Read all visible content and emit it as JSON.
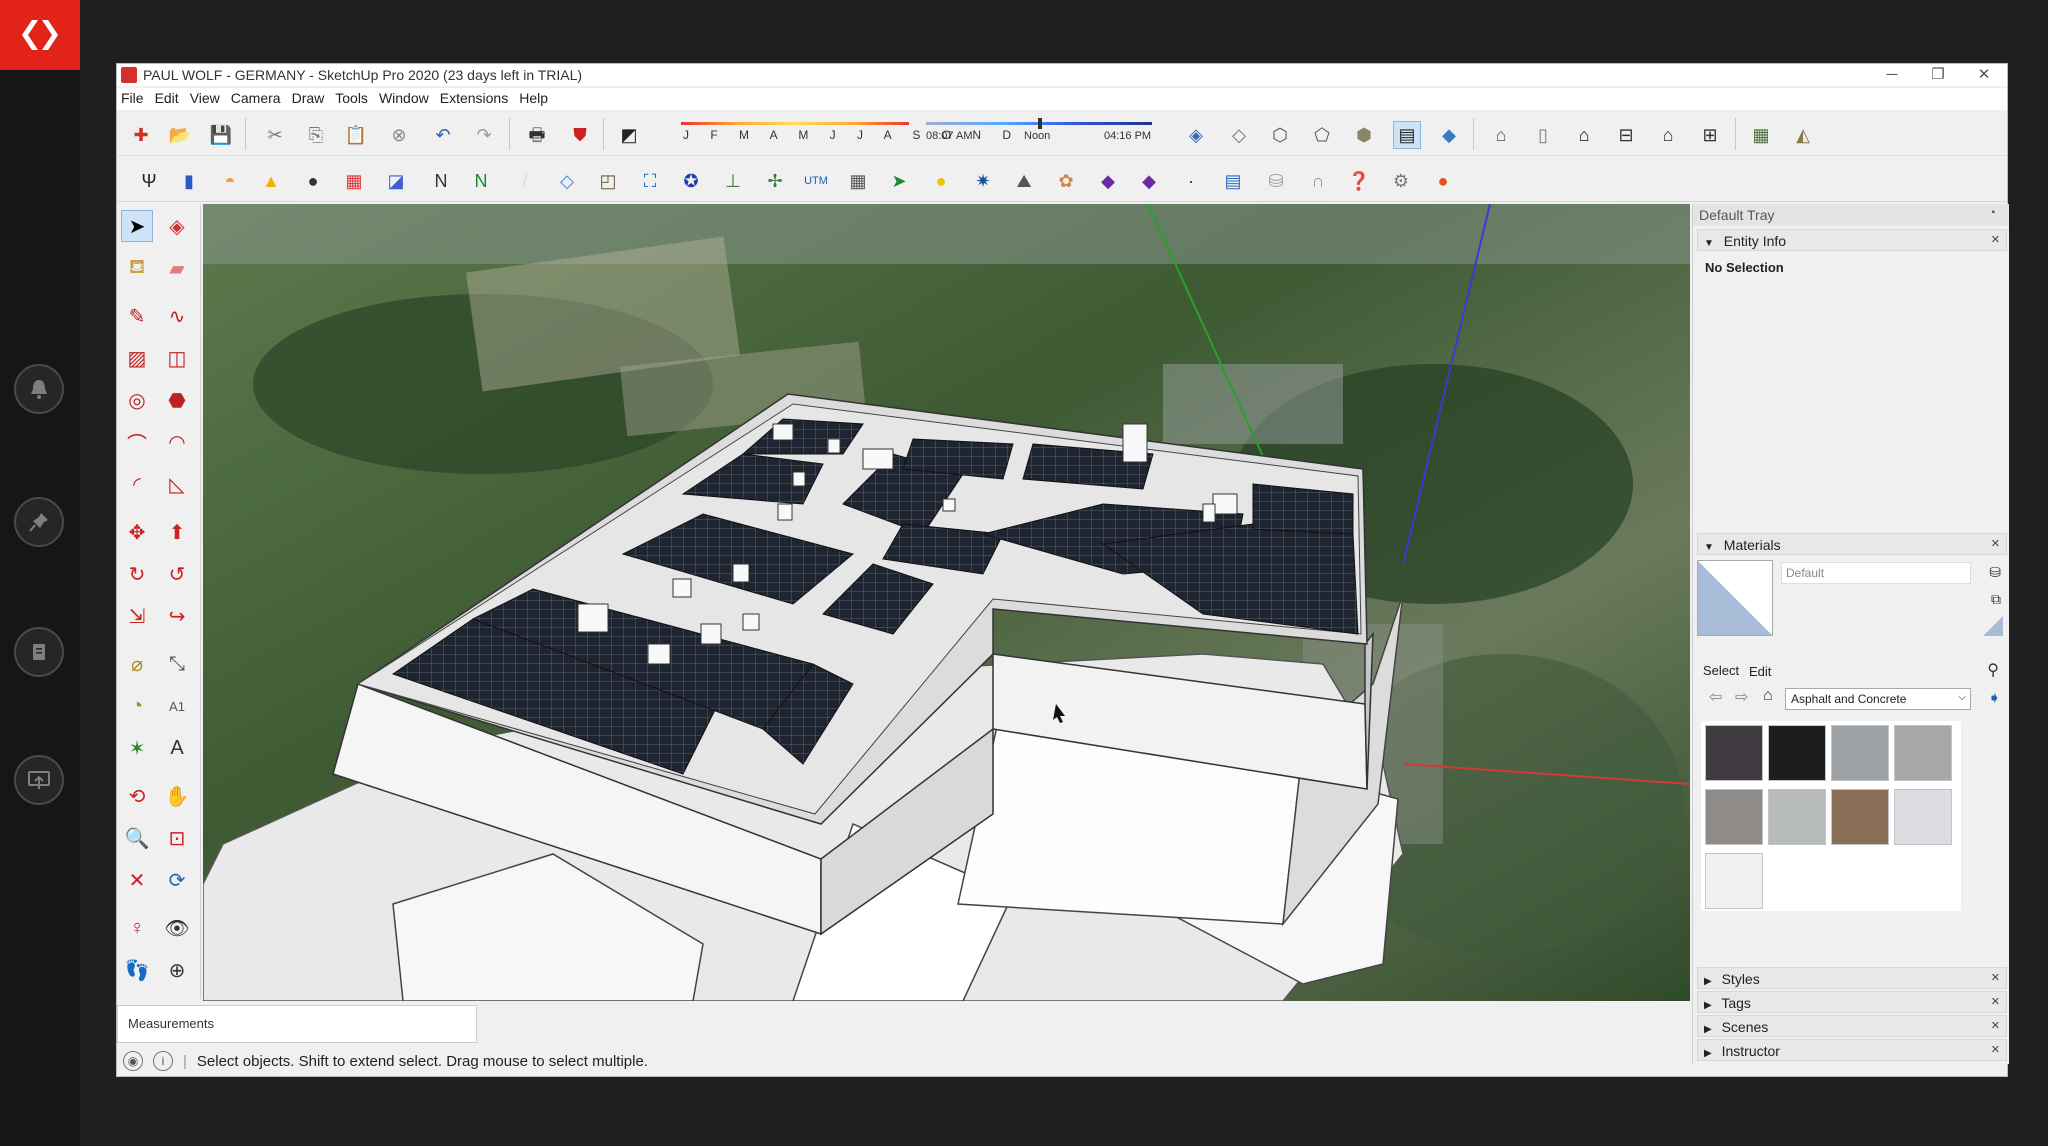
{
  "window": {
    "title": "PAUL WOLF - GERMANY - SketchUp Pro 2020 (23 days left in TRIAL)"
  },
  "menu": [
    "File",
    "Edit",
    "View",
    "Camera",
    "Draw",
    "Tools",
    "Window",
    "Extensions",
    "Help"
  ],
  "shadow": {
    "months": "J F M A M J J A S O N D",
    "time_start": "08:07 AM",
    "time_mid": "Noon",
    "time_end": "04:16 PM"
  },
  "tray": {
    "title": "Default Tray",
    "entity_info": {
      "label": "Entity Info",
      "selection": "No Selection"
    },
    "materials": {
      "label": "Materials",
      "current": "Default",
      "tab_select": "Select",
      "tab_edit": "Edit",
      "library": "Asphalt and Concrete",
      "swatch_colors": [
        "#3f3b40",
        "#1d1c1e",
        "#9da2a6",
        "#a7a9a9",
        "#8e8b89",
        "#b7bcb8",
        "#8a6f57",
        "#dcdde2",
        "#f1f1f1"
      ]
    },
    "collapsed_panels": [
      "Styles",
      "Tags",
      "Scenes",
      "Instructor"
    ]
  },
  "measurements": {
    "label": "Measurements"
  },
  "status": {
    "message": "Select objects. Shift to extend select. Drag mouse to select multiple."
  }
}
